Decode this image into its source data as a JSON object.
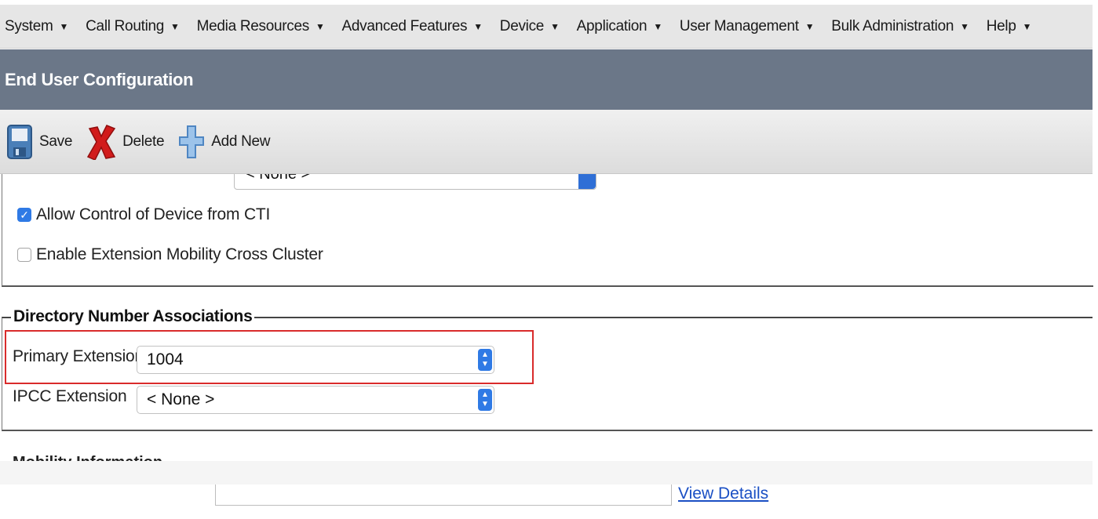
{
  "menu": [
    {
      "label": "System"
    },
    {
      "label": "Call Routing"
    },
    {
      "label": "Media Resources"
    },
    {
      "label": "Advanced Features"
    },
    {
      "label": "Device"
    },
    {
      "label": "Application"
    },
    {
      "label": "User Management"
    },
    {
      "label": "Bulk Administration"
    },
    {
      "label": "Help"
    }
  ],
  "page": {
    "title": "End User Configuration"
  },
  "toolbar": {
    "save_label": "Save",
    "delete_label": "Delete",
    "add_new_label": "Add New"
  },
  "cut_field_value": "< None >",
  "checks": {
    "allow_cti": {
      "label": "Allow Control of Device from CTI",
      "checked": true
    },
    "em_cross_cluster": {
      "label": "Enable Extension Mobility Cross Cluster",
      "checked": false
    }
  },
  "dn_associations": {
    "legend": "Directory Number Associations",
    "primary_extension": {
      "label": "Primary Extension",
      "value": "1004"
    },
    "ipcc_extension": {
      "label": "IPCC Extension",
      "value": "< None >"
    }
  },
  "mobility": {
    "legend": "Mobility Information"
  },
  "view_details_label": "View Details",
  "colors": {
    "title_bar": "#6b7788",
    "highlight": "#d92b2b",
    "link": "#1a4fc4",
    "accent_blue": "#2f7ae5"
  }
}
